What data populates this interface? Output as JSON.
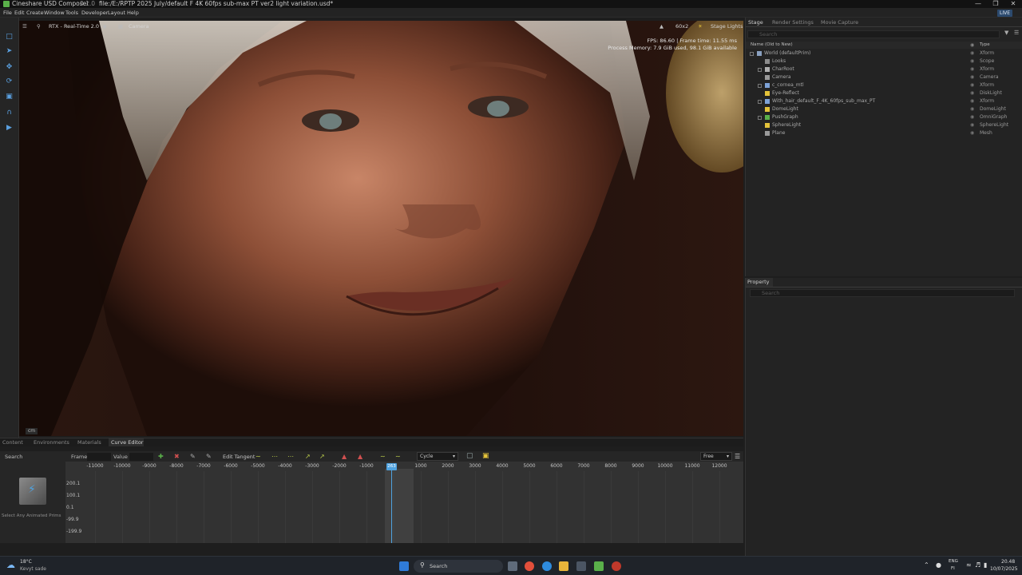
{
  "window": {
    "app_name": "Cineshare USD Composer",
    "version": "0.1.0",
    "file_path": "file:/E:/RPTP 2025 July/default F 4K 60fps sub-max PT ver2 light variation.usd*",
    "minimize_icon": "minimize-icon",
    "maximize_icon": "restore-icon",
    "close_icon": "close-icon"
  },
  "menu": {
    "items": [
      "File",
      "Edit",
      "Create",
      "Window",
      "Tools",
      "Developer",
      "Layout",
      "Help"
    ],
    "live_label": "LIVE"
  },
  "viewport": {
    "renderer_label": "RTX - Real-Time 2.0",
    "camera_label": "Camera",
    "resolution_label": "60x2",
    "stage_lights_label": "Stage Lights",
    "fps_line": "FPS: 86.60  |  Frame time: 11.55 ms",
    "memory_line": "Process Memory: 7.9 GiB used, 98.1 GiB available",
    "units_badge": "cm"
  },
  "stage_panel": {
    "tabs": [
      "Stage",
      "Render Settings",
      "Movie Capture"
    ],
    "search_placeholder": "Search",
    "col_name": "Name (Old to New)",
    "col_type": "Type",
    "rows": [
      {
        "name": "World (defaultPrim)",
        "type": "Xform",
        "indent": 0,
        "icon_color": "#8aa0c0"
      },
      {
        "name": "Looks",
        "type": "Scope",
        "indent": 1,
        "icon_color": "#8c8c8c"
      },
      {
        "name": "CharRoot",
        "type": "Xform",
        "indent": 1,
        "icon_color": "#b0b0b0"
      },
      {
        "name": "Camera",
        "type": "Camera",
        "indent": 1,
        "icon_color": "#9a9a9a"
      },
      {
        "name": "c_cornea_mtl",
        "type": "Xform",
        "indent": 1,
        "icon_color": "#7da2d8"
      },
      {
        "name": "Eye-Reflect",
        "type": "DiskLight",
        "indent": 1,
        "icon_color": "#e3c23a"
      },
      {
        "name": "With_hair_default_F_4K_60fps_sub_max_PT",
        "type": "Xform",
        "indent": 1,
        "icon_color": "#7da2d8"
      },
      {
        "name": "DomeLight",
        "type": "DomeLight",
        "indent": 1,
        "icon_color": "#e3c23a"
      },
      {
        "name": "PushGraph",
        "type": "OmniGraph",
        "indent": 1,
        "icon_color": "#5ab04a"
      },
      {
        "name": "SphereLight",
        "type": "SphereLight",
        "indent": 1,
        "icon_color": "#e3c23a"
      },
      {
        "name": "Plane",
        "type": "Mesh",
        "indent": 1,
        "icon_color": "#9a9a9a"
      }
    ]
  },
  "property_panel": {
    "tab": "Property",
    "search_placeholder": "Search"
  },
  "bottom_tabs": [
    "Content",
    "Environments",
    "Materials",
    "Curve Editor"
  ],
  "curve_editor": {
    "search_label": "Search",
    "frame_label": "Frame",
    "value_label": "Value",
    "edit_tangent_label": "Edit Tangent",
    "cycle_value": "Cycle",
    "free_value": "Free",
    "select_hint": "Select Any Animated Prims",
    "ticks": [
      "-11000",
      "-10000",
      "-9000",
      "-8000",
      "-7000",
      "-6000",
      "-5000",
      "-4000",
      "-3000",
      "-2000",
      "-1000",
      "0",
      "1000",
      "2000",
      "3000",
      "4000",
      "5000",
      "6000",
      "7000",
      "8000",
      "9000",
      "10000",
      "11000",
      "12000"
    ],
    "playhead_label": "263",
    "value_labels": [
      "200.1",
      "100.1",
      "0.1",
      "-99.9",
      "-199.9"
    ]
  },
  "taskbar": {
    "weather_temp": "18°C",
    "weather_text": "Kevyt sade",
    "search_label": "Search",
    "lang_top": "ENG",
    "lang_bottom": "FI",
    "time": "20.48",
    "date": "10/07/2025"
  }
}
